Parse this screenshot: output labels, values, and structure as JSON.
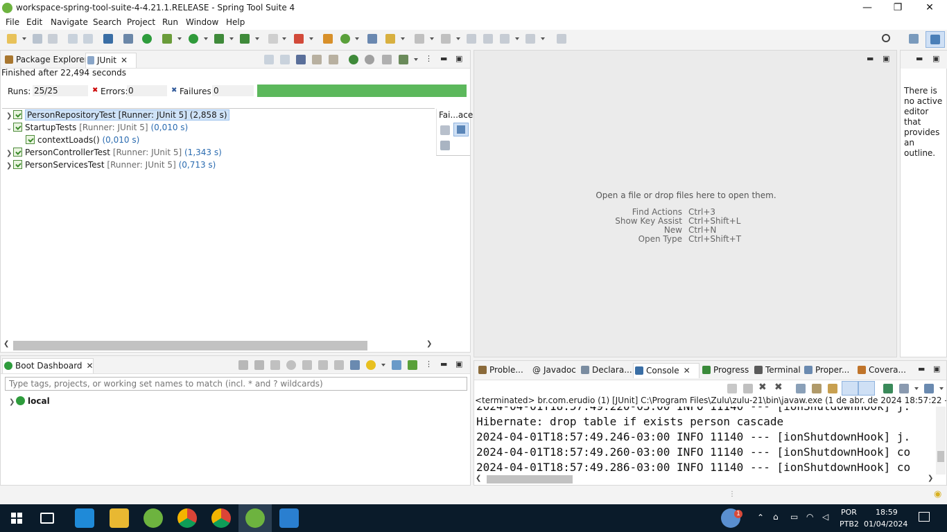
{
  "window": {
    "title": "workspace-spring-tool-suite-4-4.21.1.RELEASE - Spring Tool Suite 4",
    "minimize": "—",
    "restore": "❐",
    "close": "✕"
  },
  "menu": [
    "File",
    "Edit",
    "Navigate",
    "Search",
    "Project",
    "Run",
    "Window",
    "Help"
  ],
  "junit_panel": {
    "tabs": [
      {
        "label": "Package Explorer",
        "icon": "package-explorer-icon"
      },
      {
        "label": "JUnit",
        "icon": "junit-icon"
      }
    ],
    "status": "Finished after 22,494 seconds",
    "runs_label": "Runs:",
    "runs_value": "25/25",
    "errors_label": "Errors:",
    "errors_value": "0",
    "failures_label": "Failures:",
    "failures_value": "0",
    "progress_percent": 100,
    "progress_color": "#5cb85c",
    "trace_label": "Fai...ace",
    "tests": [
      {
        "name": "PersonRepositoryTest",
        "runner": "[Runner: JUnit 5]",
        "time": "(2,858 s)",
        "expanded": false,
        "selected": true
      },
      {
        "name": "StartupTests",
        "runner": "[Runner: JUnit 5]",
        "time": "(0,010 s)",
        "expanded": true,
        "selected": false
      },
      {
        "name": "contextLoads()",
        "runner": "",
        "time": "(0,010 s)",
        "child": true
      },
      {
        "name": "PersonControllerTest",
        "runner": "[Runner: JUnit 5]",
        "time": "(1,343 s)",
        "expanded": false
      },
      {
        "name": "PersonServicesTest",
        "runner": "[Runner: JUnit 5]",
        "time": "(0,713 s)",
        "expanded": false
      }
    ]
  },
  "editor_area": {
    "message": "Open a file or drop files here to open them.",
    "shortcuts": [
      {
        "action": "Find Actions",
        "key": "Ctrl+3"
      },
      {
        "action": "Show Key Assist",
        "key": "Ctrl+Shift+L"
      },
      {
        "action": "New",
        "key": "Ctrl+N"
      },
      {
        "action": "Open Type",
        "key": "Ctrl+Shift+T"
      }
    ]
  },
  "outline": {
    "message": "There is no active editor that provides an outline."
  },
  "boot_dashboard": {
    "tab": "Boot Dashboard",
    "filter_placeholder": "Type tags, projects, or working set names to match (incl. * and ? wildcards)",
    "items": [
      {
        "label": "local"
      }
    ]
  },
  "console_panel": {
    "tabs": [
      "Proble...",
      "Javadoc",
      "Declara...",
      "Console",
      "Progress",
      "Terminal",
      "Proper...",
      "Covera..."
    ],
    "header": "<terminated> br.com.erudio (1) [JUnit] C:\\Program Files\\Zulu\\zulu-21\\bin\\javaw.exe  (1 de abr. de 2024 18:57:22 – 18:57:49) [pid:",
    "lines": [
      "2024-04-01T18:57:49.220-03:00  INFO 11140 --- [ionShutdownHook] j.",
      "Hibernate: drop table if exists person cascade",
      "2024-04-01T18:57:49.246-03:00  INFO 11140 --- [ionShutdownHook] j.",
      "2024-04-01T18:57:49.260-03:00  INFO 11140 --- [ionShutdownHook] co",
      "2024-04-01T18:57:49.286-03:00  INFO 11140 --- [ionShutdownHook] co"
    ]
  },
  "taskbar": {
    "apps": [
      "windows-start",
      "task-view",
      "vscode",
      "file-explorer",
      "spring-tool-suite",
      "chrome",
      "chrome",
      "spring-tool-suite-active",
      "image-viewer"
    ],
    "weather_badge": "1",
    "lang_line1": "POR",
    "lang_line2": "PTB2",
    "time": "18:59",
    "date": "01/04/2024"
  }
}
